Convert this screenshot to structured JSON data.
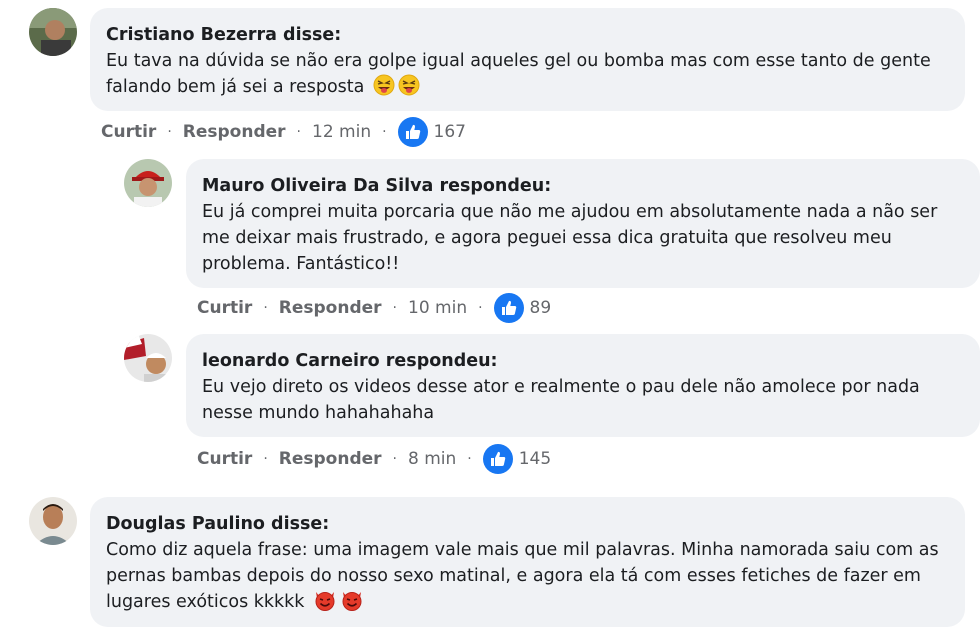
{
  "comments": [
    {
      "author": "Cristiano Bezerra disse:",
      "text": "Eu tava na dúvida se não era golpe igual aqueles gel ou bomba mas com esse tanto de gente falando bem já sei a resposta",
      "emoji": [
        "squinting-tongue-emoji",
        "squinting-tongue-emoji"
      ],
      "like_label": "Curtir",
      "reply_label": "Responder",
      "time": "12 min",
      "likes": "167"
    },
    {
      "author": "Mauro Oliveira Da Silva respondeu:",
      "text": "Eu já comprei muita porcaria que não me ajudou em absolutamente nada a não ser me deixar mais frustrado, e agora peguei essa dica gratuita que resolveu meu problema. Fantástico!!",
      "like_label": "Curtir",
      "reply_label": "Responder",
      "time": "10 min",
      "likes": "89"
    },
    {
      "author": "leonardo Carneiro respondeu:",
      "text": "Eu vejo direto os videos desse ator e realmente o pau dele não amolece por nada nesse mundo hahahahaha",
      "like_label": "Curtir",
      "reply_label": "Responder",
      "time": "8 min",
      "likes": "145"
    },
    {
      "author": "Douglas Paulino disse:",
      "text": "Como diz aquela frase: uma imagem vale mais que mil palavras. Minha namorada saiu com as pernas bambas depois do nosso sexo matinal, e agora ela tá com esses fetiches de fazer em lugares exóticos kkkkk",
      "emoji": [
        "smiling-devil-emoji",
        "smiling-devil-emoji"
      ]
    }
  ],
  "colors": {
    "bubble": "#f0f2f5",
    "like_blue": "#1877f2",
    "meta_gray": "#65676b",
    "text": "#1c1e21"
  }
}
